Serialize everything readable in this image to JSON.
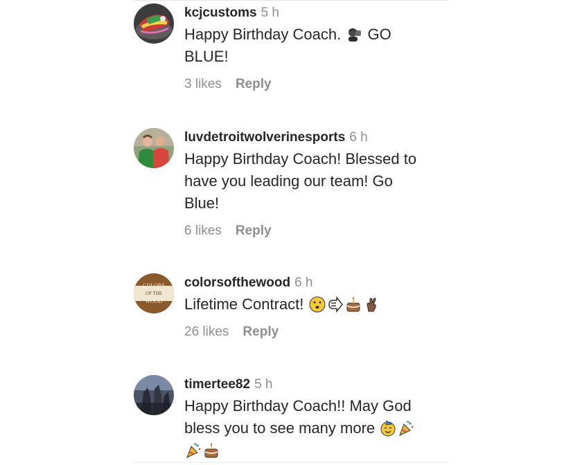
{
  "comments": [
    {
      "username": "kcjcustoms",
      "time": "5 h",
      "text_parts": [
        "Happy Birthday Coach. ",
        " GO",
        "BLUE!"
      ],
      "emojis": [
        "coach-emoji"
      ],
      "likes": "3 likes",
      "reply": "Reply"
    },
    {
      "username": "luvdetroitwolverinesports",
      "time": "6 h",
      "text_lines": [
        "Happy Birthday Coach! Blessed to",
        "have you leading our team! Go",
        "Blue!"
      ],
      "likes": "6 likes",
      "reply": "Reply"
    },
    {
      "username": "colorsofthewood",
      "time": "6 h",
      "text": "Lifetime Contract! ",
      "emojis": [
        "hushed-face-emoji",
        "right-arrow-emoji",
        "cake-emoji",
        "crossed-fingers-emoji"
      ],
      "avatar_text": [
        "COLORS",
        "OF THE",
        "WOOD"
      ],
      "likes": "26 likes",
      "reply": "Reply"
    },
    {
      "username": "timertee82",
      "time": "5 h",
      "text_parts": [
        "Happy Birthday Coach!! May God",
        "bless you to see many more "
      ],
      "emojis": [
        "party-face-emoji",
        "party-popper-emoji",
        "party-popper-emoji",
        "cake-emoji"
      ]
    }
  ],
  "colors": {
    "username": "#262626",
    "meta": "#8e8e8e",
    "text": "#262626"
  }
}
